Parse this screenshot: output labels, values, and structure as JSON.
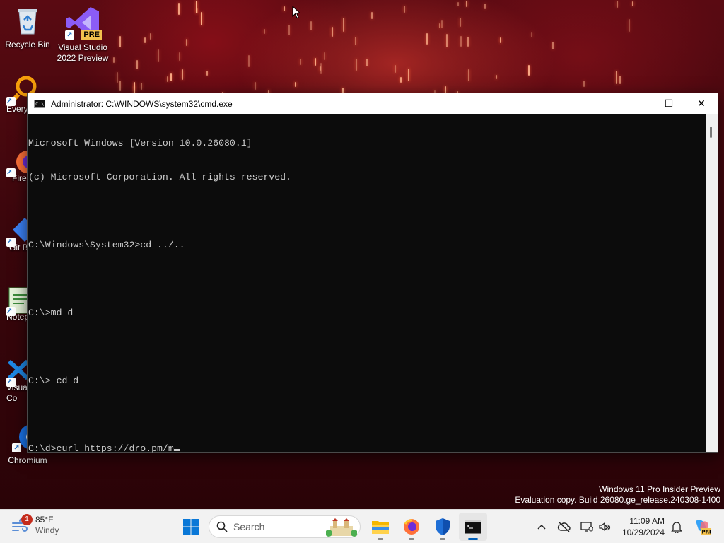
{
  "desktop": {
    "icons": [
      {
        "label": "Recycle Bin"
      },
      {
        "label": "Visual Studio 2022 Preview",
        "badge": "PRE"
      },
      {
        "label": "Every"
      },
      {
        "label": "Fire"
      },
      {
        "label": "Git B"
      },
      {
        "label": "Notep"
      },
      {
        "label": "Visual Co"
      },
      {
        "label": "Chromium"
      }
    ]
  },
  "cmd": {
    "title": "Administrator: C:\\WINDOWS\\system32\\cmd.exe",
    "lines": [
      "Microsoft Windows [Version 10.0.26080.1]",
      "(c) Microsoft Corporation. All rights reserved.",
      "",
      "C:\\Windows\\System32>cd ../..",
      "",
      "C:\\>md d",
      "",
      "C:\\> cd d",
      "",
      "C:\\d>curl https://dro.pm/m"
    ],
    "controls": {
      "minimize": "—",
      "maximize": "☐",
      "close": "✕"
    }
  },
  "watermark": {
    "line1": "Windows 11 Pro Insider Preview",
    "line2": "Evaluation copy. Build 26080.ge_release.240308-1400"
  },
  "taskbar": {
    "weather": {
      "temp": "85°F",
      "condition": "Windy",
      "badge": "1"
    },
    "search_placeholder": "Search",
    "clock": {
      "time": "11:09 AM",
      "date": "10/29/2024"
    },
    "colors": {
      "start_blue": "#0a78d7",
      "accent": "#005fb8"
    }
  }
}
